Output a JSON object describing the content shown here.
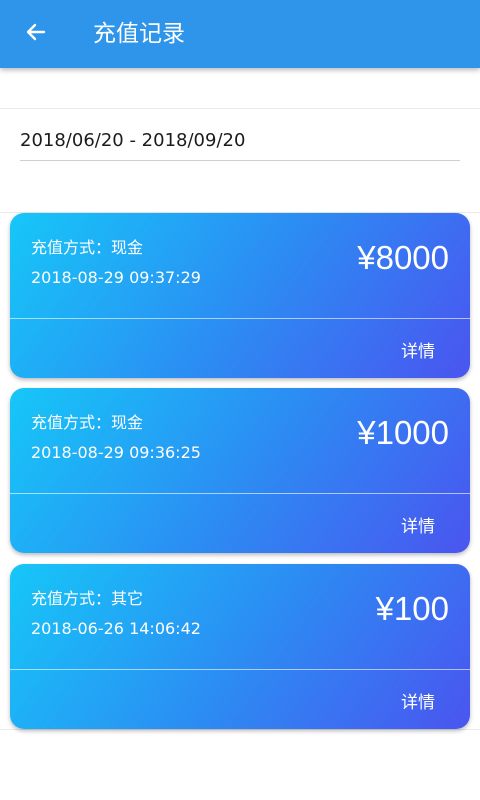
{
  "header": {
    "title": "充值记录",
    "back_icon": "arrow-left-icon"
  },
  "filter": {
    "date_range": "2018/06/20 - 2018/09/20"
  },
  "records": [
    {
      "method_label": "充值方式：现金",
      "time": "2018-08-29 09:37:29",
      "amount": "¥8000",
      "detail_label": "详情"
    },
    {
      "method_label": "充值方式：现金",
      "time": "2018-08-29 09:36:25",
      "amount": "¥1000",
      "detail_label": "详情"
    },
    {
      "method_label": "充值方式：其它",
      "time": "2018-06-26 14:06:42",
      "amount": "¥100",
      "detail_label": "详情"
    }
  ],
  "colors": {
    "header_bg": "#2f95ea",
    "card_gradient_start": "#16c7f8",
    "card_gradient_end": "#4a55f0"
  }
}
